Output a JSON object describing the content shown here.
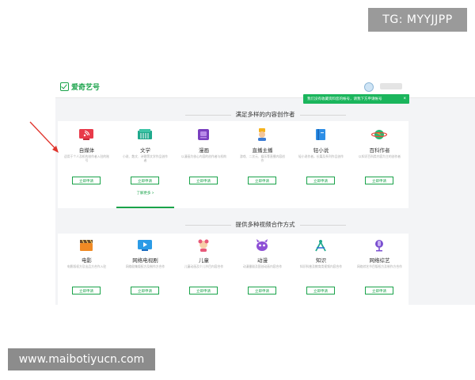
{
  "watermarks": {
    "top": "TG: MYYJJPP",
    "bottom": "www.maibotiyucn.com"
  },
  "header": {
    "logo_text": "爱奇艺号"
  },
  "notification": {
    "text": "我们没有收藏资料您的帐号，请我下方申请帐号",
    "close": "×"
  },
  "sections": [
    {
      "title": "满足多样的内容创作者",
      "cards": [
        {
          "label": "自媒体",
          "icon": "rss-screen-icon",
          "desc": "适用于个人及机构创作者入驻的账号",
          "button": "立即申请"
        },
        {
          "label": "文学",
          "icon": "book-icon",
          "desc": "小说、散文、诗歌等文学作品创作者",
          "button": "立即申请",
          "link": "了解更多 >",
          "active": true
        },
        {
          "label": "漫画",
          "icon": "comic-icon",
          "desc": "以漫画为核心内容的创作者与机构",
          "button": "立即申请"
        },
        {
          "label": "直播主播",
          "icon": "anchor-icon",
          "desc": "游戏、二次元、娱乐等直播内容创作",
          "button": "立即申请"
        },
        {
          "label": "轻小说",
          "icon": "light-novel-icon",
          "desc": "轻小说作者，长篇及系列作品创作",
          "button": "立即申请"
        },
        {
          "label": "百科作者",
          "icon": "planet-icon",
          "desc": "以知识百科类内容为主的创作者",
          "button": "立即申请"
        }
      ]
    },
    {
      "title": "提供多种视频合作方式",
      "cards": [
        {
          "label": "电影",
          "icon": "clapperboard-icon",
          "desc": "电影版权方及出品方合作入驻",
          "button": "立即申请"
        },
        {
          "label": "网络电视剧",
          "icon": "tv-icon",
          "desc": "网络剧集版权方及制作方合作",
          "button": "立即申请"
        },
        {
          "label": "儿童",
          "icon": "kid-icon",
          "desc": "儿童动画及少儿节目内容合作",
          "button": "立即申请"
        },
        {
          "label": "动漫",
          "icon": "monster-icon",
          "desc": "动漫番剧及国创动画内容合作",
          "button": "立即申请"
        },
        {
          "label": "知识",
          "icon": "compass-icon",
          "desc": "知识科普及教育类视频内容合作",
          "button": "立即申请"
        },
        {
          "label": "网络综艺",
          "icon": "microphone-icon",
          "desc": "网络综艺节目版权方及制作方合作",
          "button": "立即申请"
        }
      ]
    }
  ],
  "colors": {
    "brand": "#1aa34a",
    "toast": "#1ab55c",
    "arrow": "#e0342c"
  }
}
